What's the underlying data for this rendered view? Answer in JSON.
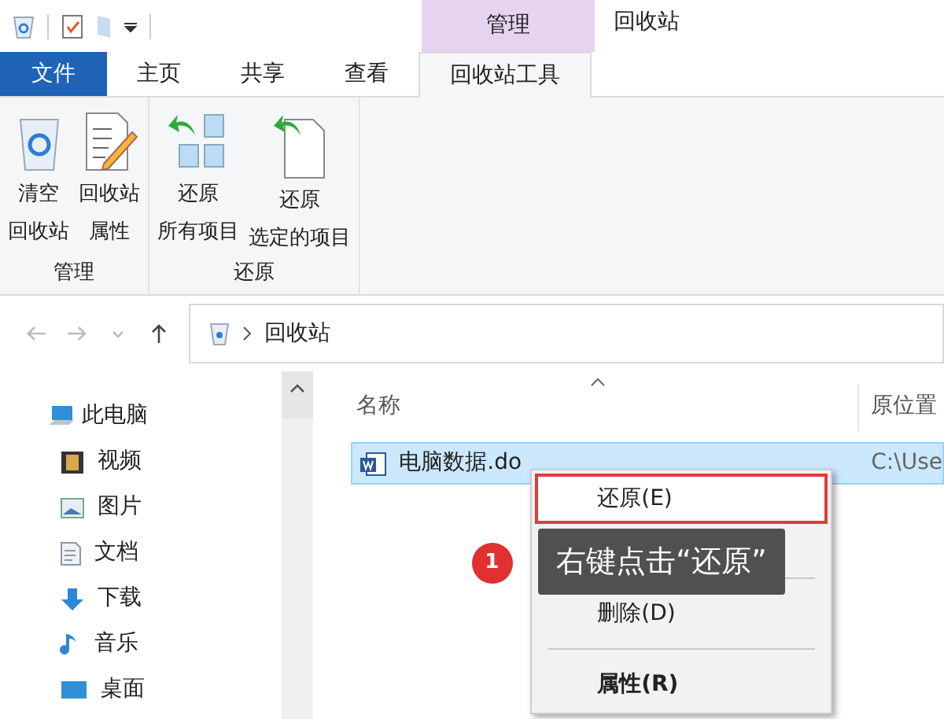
{
  "window": {
    "title": "回收站",
    "context_tab": "管理"
  },
  "file_menu": "文件",
  "ribbon_tabs": [
    {
      "label": "主页",
      "selected": false
    },
    {
      "label": "共享",
      "selected": false
    },
    {
      "label": "查看",
      "selected": false
    },
    {
      "label": "回收站工具",
      "selected": true
    }
  ],
  "ribbon_groups": [
    {
      "label": "管理",
      "buttons": [
        {
          "lines": [
            "清空",
            "回收站"
          ]
        },
        {
          "lines": [
            "回收站",
            "属性"
          ]
        }
      ]
    },
    {
      "label": "还原",
      "buttons": [
        {
          "lines": [
            "还原",
            "所有项目"
          ]
        },
        {
          "lines": [
            "还原",
            "选定的项目"
          ]
        }
      ]
    }
  ],
  "address": {
    "path": "回收站"
  },
  "nav": [
    {
      "label": "此电脑",
      "children": [
        {
          "label": "视频"
        },
        {
          "label": "图片"
        },
        {
          "label": "文档"
        },
        {
          "label": "下载"
        },
        {
          "label": "音乐"
        },
        {
          "label": "桌面"
        }
      ]
    }
  ],
  "table": {
    "columns": [
      "名称",
      "原位置"
    ],
    "rows": [
      {
        "name": "电脑数据.do",
        "location": "C:\\Use",
        "selected": true
      }
    ]
  },
  "context_menu": [
    {
      "kind": "item",
      "label": "还原(E)",
      "highlighted": true,
      "bold": false
    },
    {
      "kind": "spacer"
    },
    {
      "kind": "separator"
    },
    {
      "kind": "item",
      "label": "删除(D)",
      "highlighted": false,
      "bold": false
    },
    {
      "kind": "separator"
    },
    {
      "kind": "item",
      "label": "属性(R)",
      "highlighted": false,
      "bold": true
    }
  ],
  "annotation": {
    "number": "1",
    "text": "右键点击“还原”"
  }
}
